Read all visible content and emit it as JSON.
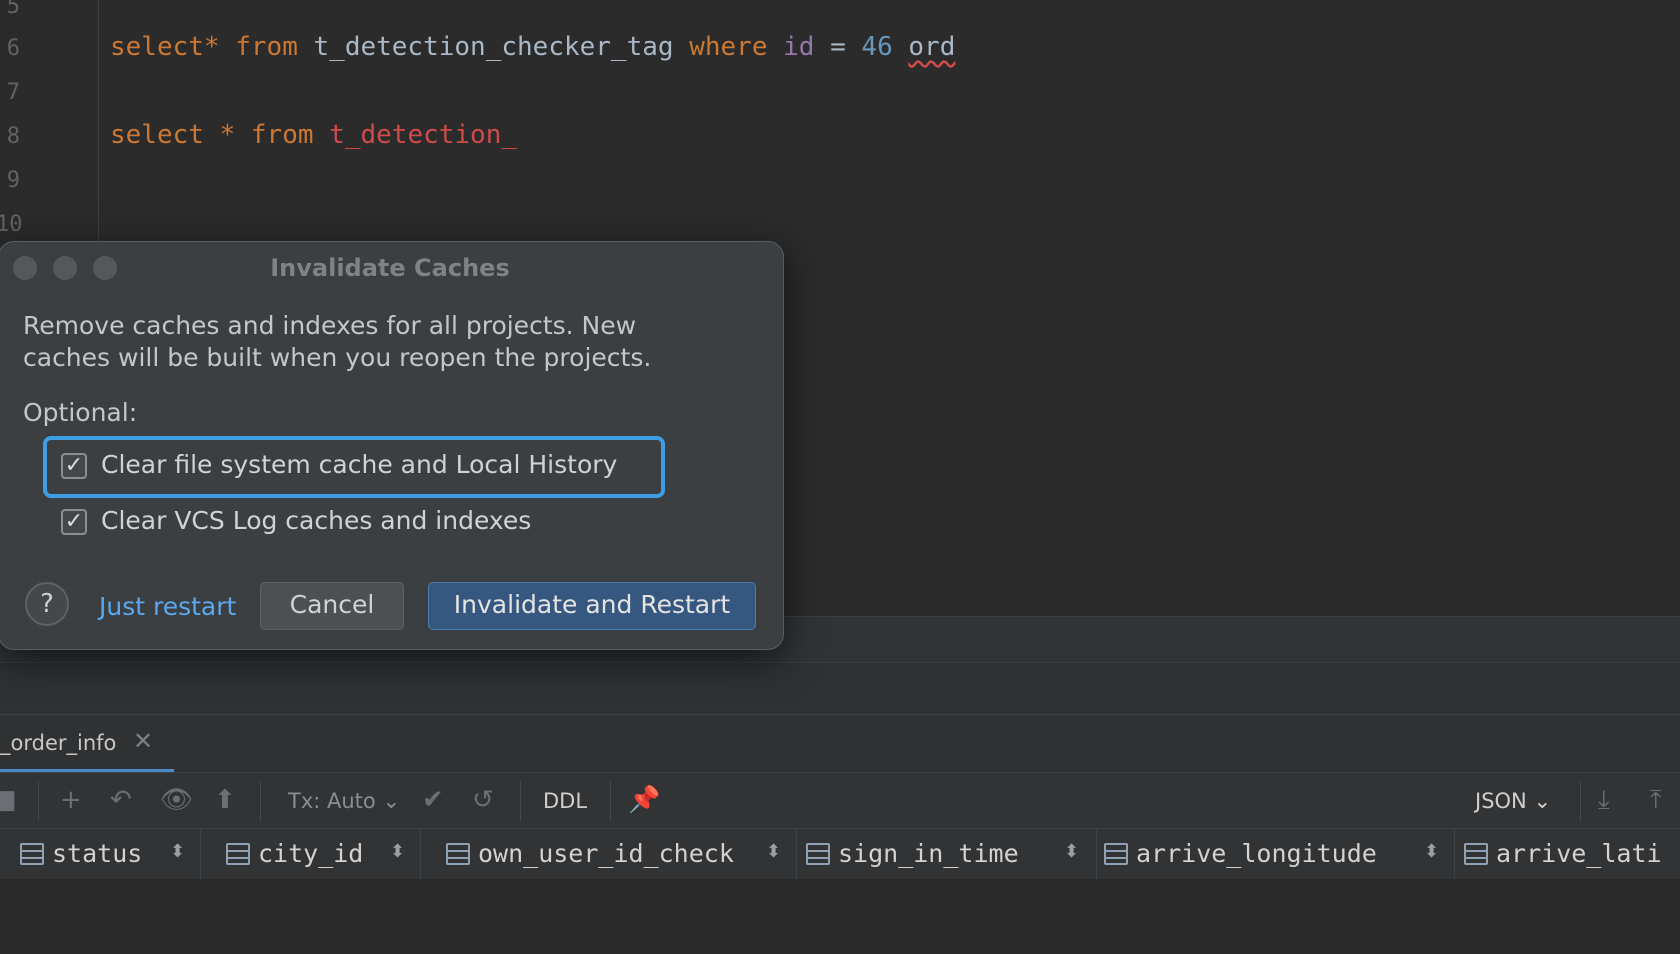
{
  "editor": {
    "line_numbers": [
      "5",
      "6",
      "7",
      "8",
      "9",
      "10"
    ],
    "line6": {
      "kw_select": "select",
      "star": "*",
      "kw_from": "from",
      "table": "t_detection_checker_tag",
      "kw_where": "where",
      "column": "id",
      "eq": "=",
      "value": "46",
      "trailing": "ord"
    },
    "line8": {
      "kw_select": "select",
      "star": "*",
      "kw_from": "from",
      "table": "t_detection_"
    }
  },
  "results": {
    "tab_label": "_order_info",
    "toolbar": {
      "tx_label": "Tx: Auto",
      "ddl_label": "DDL",
      "format_label": "JSON"
    },
    "columns": [
      "status",
      "city_id",
      "own_user_id_check",
      "sign_in_time",
      "arrive_longitude",
      "arrive_lati"
    ]
  },
  "dialog": {
    "title": "Invalidate Caches",
    "message": "Remove caches and indexes for all projects. New caches will be built when you reopen the projects.",
    "optional_label": "Optional:",
    "options": [
      {
        "label": "Clear file system cache and Local History",
        "checked": true
      },
      {
        "label": "Clear VCS Log caches and indexes",
        "checked": true
      }
    ],
    "help_label": "?",
    "just_restart_label": "Just restart",
    "cancel_label": "Cancel",
    "primary_label": "Invalidate and Restart"
  },
  "colors": {
    "accent": "#3d9ee6",
    "primary_button": "#365880",
    "link": "#5aa8f0",
    "keyword": "#cc7832",
    "error": "#d04a4a",
    "number": "#6897bb"
  }
}
